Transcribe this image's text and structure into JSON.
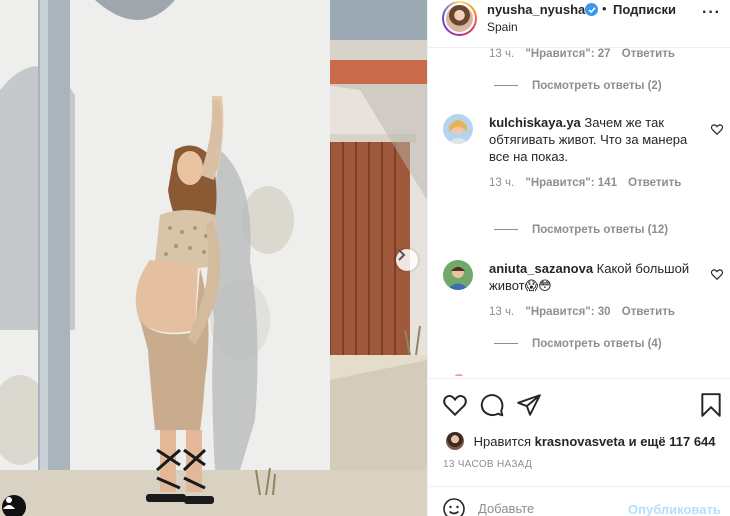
{
  "post": {
    "author": "nyusha_nyusha",
    "follow_label": "Подписки",
    "location": "Spain",
    "verified": true,
    "more_icon": "more-dots-icon"
  },
  "comments_list": {
    "top_meta": {
      "time": "13 ч.",
      "likes": "\"Нравится\": 27",
      "reply": "Ответить"
    },
    "top_replies": "Посмотреть ответы (2)",
    "items": [
      {
        "username": "kulchiskaya.ya",
        "text": "Зачем же так обтягивать живот. Что за манера все на показ.",
        "time": "13 ч.",
        "likes": "\"Нравится\": 141",
        "reply": "Ответить",
        "view_replies": "Посмотреть ответы (12)"
      },
      {
        "username": "aniuta_sazanova",
        "text": "Какой большой живот😱😳",
        "time": "13 ч.",
        "likes": "\"Нравится\": 30",
        "reply": "Ответить",
        "view_replies": "Посмотреть ответы (4)"
      }
    ]
  },
  "actions": {
    "like_icon": "heart-icon",
    "comment_icon": "comment-icon",
    "share_icon": "share-icon",
    "save_icon": "bookmark-icon"
  },
  "likes_summary": {
    "prefix": "Нравится",
    "user": "krasnovasveta",
    "suffix": "и ещё 117 644"
  },
  "time_ago": "13 ЧАСОВ НАЗАД",
  "add_comment": {
    "placeholder": "Добавьте",
    "publish_label": "Опубликовать"
  },
  "colors": {
    "text": "#262626",
    "secondary": "#8e8e8e",
    "verified_blue": "#3897f0",
    "publish_disabled": "#b2dffc",
    "border": "#efefef"
  }
}
